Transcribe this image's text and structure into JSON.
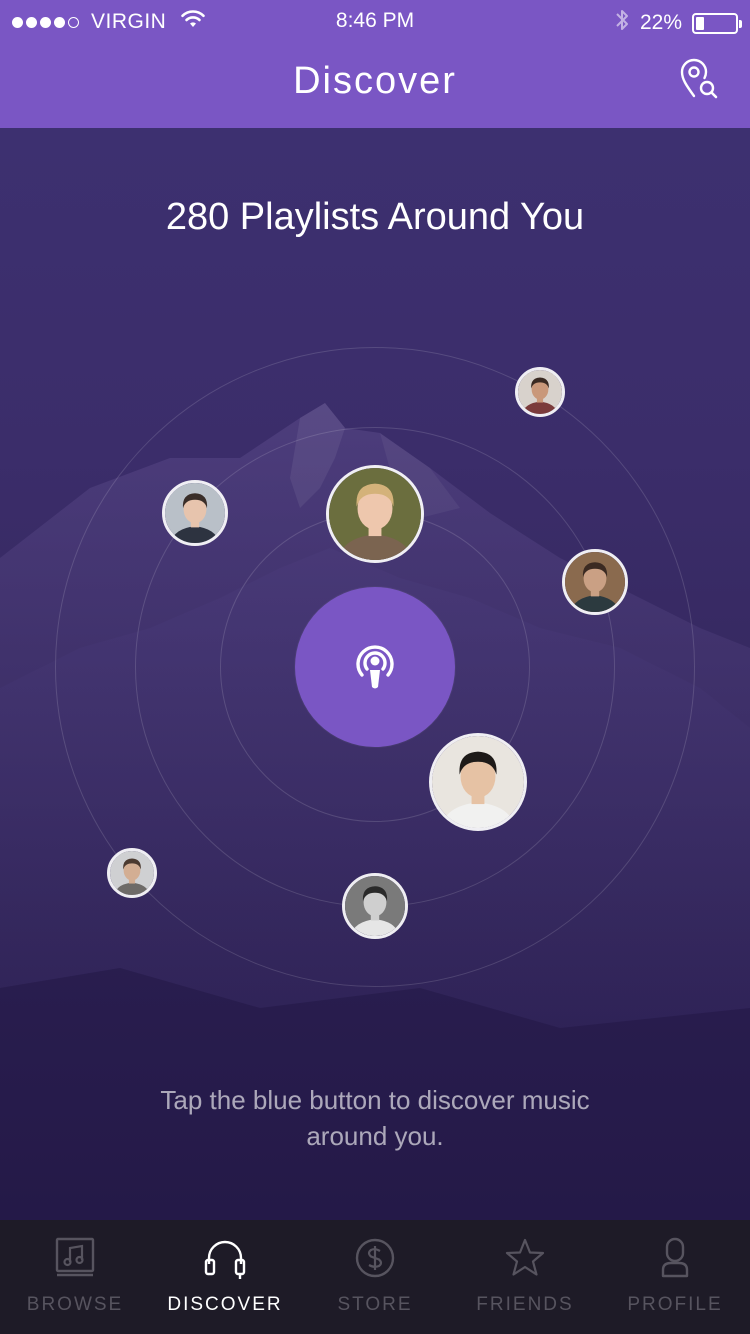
{
  "status_bar": {
    "carrier": "VIRGIN",
    "time": "8:46 PM",
    "battery_percent": "22%",
    "battery_level": 0.22,
    "signal_bars": 4,
    "signal_max": 5
  },
  "header": {
    "title": "Discover",
    "action_icon": "location-search-icon",
    "background": "#7a56c4"
  },
  "main": {
    "headline": "280 Playlists Around You",
    "hint": "Tap the blue button to discover music around you.",
    "hint_line1": "Tap the blue button to discover music",
    "hint_line2": "around you.",
    "center_button_icon": "podcast-broadcast-icon",
    "accent_color": "#7a56c4",
    "avatars": [
      {
        "name": "avatar-bearded-man-small",
        "skin": "#c9987a",
        "hair": "#3a2a22",
        "bg": "#d8d2cc",
        "shirt": "#7b3b3b"
      },
      {
        "name": "avatar-young-man-left",
        "skin": "#e7c4ad",
        "hair": "#3a2e29",
        "bg": "#b9c0c8",
        "shirt": "#2d3340"
      },
      {
        "name": "avatar-blonde-woman",
        "skin": "#eec7ad",
        "hair": "#d4b27a",
        "bg": "#6b6e3e",
        "shirt": "#7b6450"
      },
      {
        "name": "avatar-bearded-man-right",
        "skin": "#caa084",
        "hair": "#3b2a22",
        "bg": "#8a6a4e",
        "shirt": "#2c3a3f"
      },
      {
        "name": "avatar-asian-man",
        "skin": "#e6c2a4",
        "hair": "#1e1a18",
        "bg": "#e9e5df",
        "shirt": "#f1f1f0"
      },
      {
        "name": "avatar-man-bottom-left",
        "skin": "#d3ae93",
        "hair": "#4b3a30",
        "bg": "#cfd0d2",
        "shirt": "#6e6b68"
      },
      {
        "name": "avatar-woman-bw",
        "skin": "#cfcfcf",
        "hair": "#2a2a2a",
        "bg": "#7a7a7a",
        "shirt": "#e6e6e6"
      }
    ]
  },
  "tabs": [
    {
      "label": "BROWSE",
      "icon": "music-library-icon",
      "active": false
    },
    {
      "label": "DISCOVER",
      "icon": "headphones-icon",
      "active": true
    },
    {
      "label": "STORE",
      "icon": "dollar-coin-icon",
      "active": false
    },
    {
      "label": "FRIENDS",
      "icon": "star-icon",
      "active": false
    },
    {
      "label": "PROFILE",
      "icon": "person-icon",
      "active": false
    }
  ]
}
